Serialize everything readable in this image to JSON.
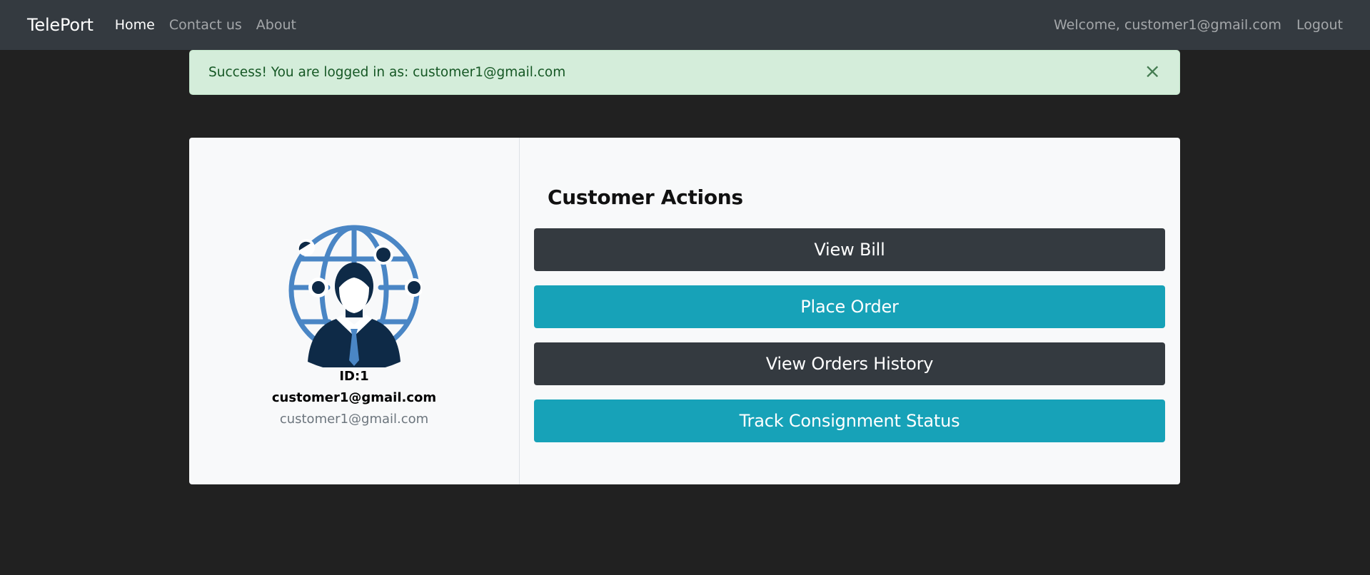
{
  "navbar": {
    "brand": "TelePort",
    "links": [
      {
        "label": "Home",
        "active": true
      },
      {
        "label": "Contact us",
        "active": false
      },
      {
        "label": "About",
        "active": false
      }
    ],
    "welcome": "Welcome, customer1@gmail.com",
    "logout": "Logout"
  },
  "alert": {
    "message": "Success! You are logged in as: customer1@gmail.com",
    "close_icon": "×"
  },
  "profile": {
    "avatar_icon": "customer-globe-icon",
    "id_label": "ID:1",
    "name": "customer1@gmail.com",
    "email": "customer1@gmail.com"
  },
  "actions": {
    "title": "Customer Actions",
    "buttons": [
      {
        "label": "View Bill",
        "style": "dark"
      },
      {
        "label": "Place Order",
        "style": "info"
      },
      {
        "label": "View Orders History",
        "style": "dark"
      },
      {
        "label": "Track Consignment Status",
        "style": "info"
      }
    ]
  },
  "colors": {
    "navbar_bg": "#343a40",
    "page_bg": "#212121",
    "alert_bg": "#d4edda",
    "dark_button": "#343a40",
    "info_button": "#17a2b8",
    "avatar_blue": "#4a86c5",
    "avatar_navy": "#0e2a47"
  }
}
